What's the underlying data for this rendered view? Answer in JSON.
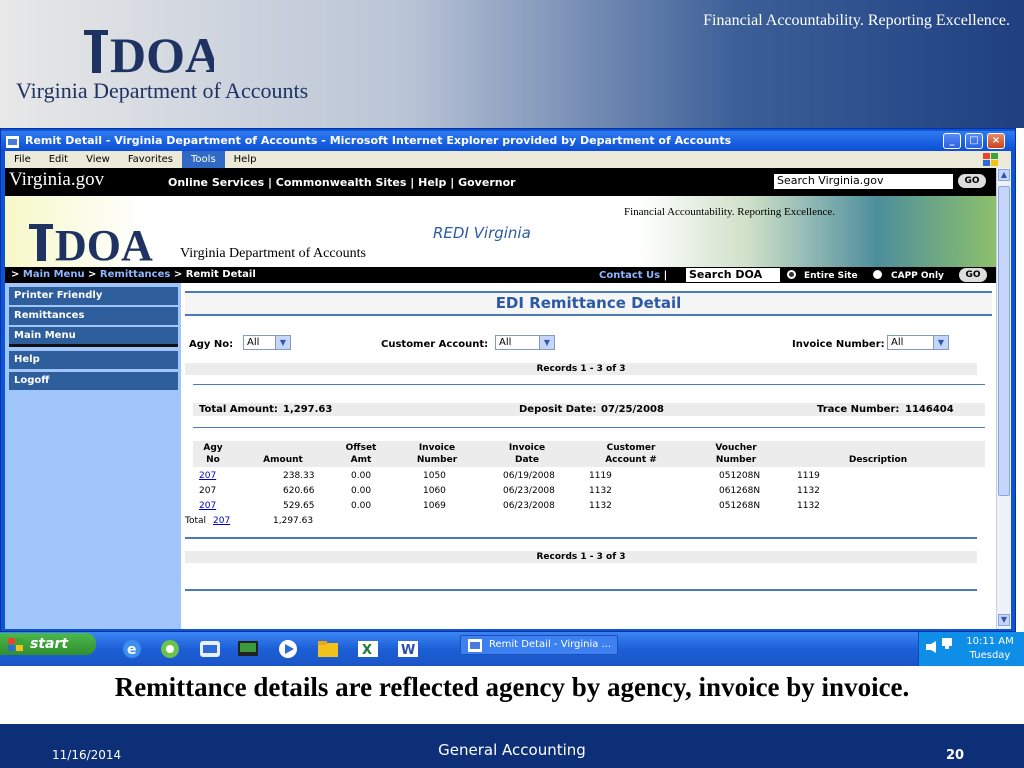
{
  "slide": {
    "logo_text": "DOA",
    "logo_subtitle": "Virginia Department of Accounts",
    "tagline": "Financial Accountability. Reporting Excellence.",
    "caption": "Remittance details are reflected agency by agency, invoice by invoice.",
    "footer_date": "11/16/2014",
    "footer_title": "General Accounting",
    "page_number": "20"
  },
  "window": {
    "title": "Remit Detail - Virginia Department of Accounts - Microsoft Internet Explorer provided by Department of Accounts",
    "menu": [
      "File",
      "Edit",
      "View",
      "Favorites",
      "Tools",
      "Help"
    ],
    "active_menu": "Tools"
  },
  "site_header": {
    "logo": "Virginia.gov",
    "links": "Online Services | Commonwealth Sites | Help | Governor",
    "search_value": "Search Virginia.gov",
    "go_label": "GO"
  },
  "banner": {
    "logo_text": "DOA",
    "subtitle": "Virginia Department of Accounts",
    "app_title": "REDI Virginia",
    "tagline": "Financial Accountability. Reporting Excellence."
  },
  "breadcrumb": {
    "prefix": "> ",
    "main_menu": "Main Menu",
    "sep": " > ",
    "remittances": "Remittances",
    "current": "Remit Detail",
    "contact": "Contact Us",
    "contact_sep": "|",
    "search_value": "Search DOA",
    "opt_entire": "Entire Site",
    "opt_capp": "CAPP Only",
    "go_label": "GO"
  },
  "sidebar": {
    "items": [
      "Printer Friendly",
      "Remittances",
      "Main Menu",
      "Help",
      "Logoff"
    ]
  },
  "main": {
    "title": "EDI Remittance Detail",
    "agy_label": "Agy No:",
    "agy_value": "All",
    "cust_label": "Customer Account:",
    "cust_value": "All",
    "inv_label": "Invoice Number:",
    "inv_value": "All",
    "records": "Records 1 - 3 of 3",
    "total_amount_label": "Total Amount:",
    "total_amount": "1,297.63",
    "deposit_date_label": "Deposit Date:",
    "deposit_date": "07/25/2008",
    "trace_label": "Trace Number:",
    "trace_number": "1146404",
    "columns": {
      "agy_1": "Agy",
      "agy_2": "No",
      "amount": "Amount",
      "offset_1": "Offset",
      "offset_2": "Amt",
      "invno_1": "Invoice",
      "invno_2": "Number",
      "invdate_1": "Invoice",
      "invdate_2": "Date",
      "cust_1": "Customer",
      "cust_2": "Account #",
      "voucher_1": "Voucher",
      "voucher_2": "Number",
      "desc": "Description"
    },
    "rows": [
      {
        "agy": "207",
        "amount": "238.33",
        "offset": "0.00",
        "invno": "1050",
        "invdate": "06/19/2008",
        "cust": "1119",
        "voucher": "051208N",
        "desc": "1119"
      },
      {
        "agy": "207",
        "amount": "620.66",
        "offset": "0.00",
        "invno": "1060",
        "invdate": "06/23/2008",
        "cust": "1132",
        "voucher": "061268N",
        "desc": "1132"
      },
      {
        "agy": "207",
        "amount": "529.65",
        "offset": "0.00",
        "invno": "1069",
        "invdate": "06/23/2008",
        "cust": "1132",
        "voucher": "051268N",
        "desc": "1132"
      }
    ],
    "total_label": "Total",
    "total_agy": "207",
    "total_value": "1,297.63"
  },
  "taskbar": {
    "start": "start",
    "item": "Remit Detail - Virginia ...",
    "time": "10:11 AM",
    "day": "Tuesday"
  },
  "colors": {
    "ie_blue": "#0a54d8",
    "nav_blue": "#2e5e9c",
    "sidebar_bg": "#9fc5fa",
    "accent": "#2b59a6",
    "footer": "#0c2f78"
  }
}
